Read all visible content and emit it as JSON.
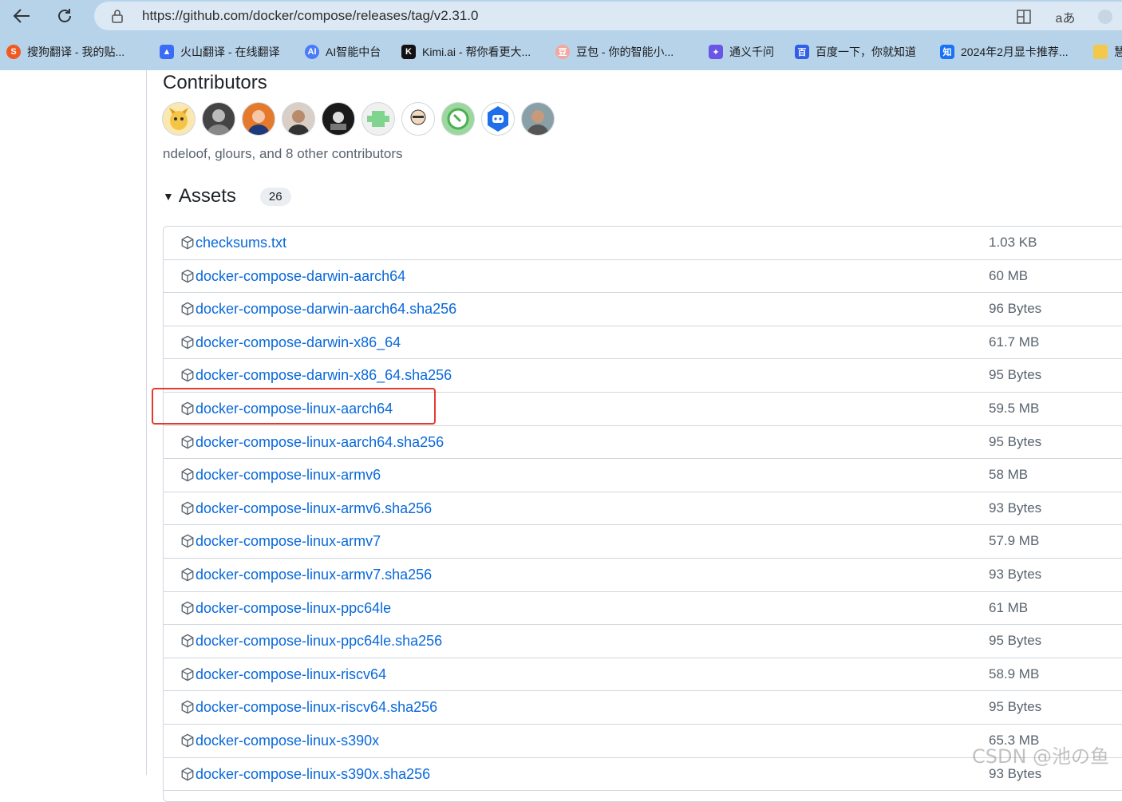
{
  "browser": {
    "url": "https://github.com/docker/compose/releases/tag/v2.31.0",
    "bookmarks": [
      {
        "label": "搜狗翻译 - 我的贴...",
        "icon": "sogou-icon",
        "color": "#f05a22"
      },
      {
        "label": "火山翻译 - 在线翻译",
        "icon": "volcano-icon",
        "color": "#3b6cf6"
      },
      {
        "label": "AI智能中台",
        "icon": "ai-icon",
        "color": "#4a7cf7"
      },
      {
        "label": "Kimi.ai - 帮你看更大...",
        "icon": "kimi-icon",
        "color": "#111111"
      },
      {
        "label": "豆包 - 你的智能小...",
        "icon": "doubao-icon",
        "color": "#f2a7a0"
      },
      {
        "label": "通义千问",
        "icon": "tongyi-icon",
        "color": "#6a55e6"
      },
      {
        "label": "百度一下，你就知道",
        "icon": "baidu-icon",
        "color": "#2f5fe6"
      },
      {
        "label": "2024年2月显卡推荐...",
        "icon": "zhihu-icon",
        "color": "#1772f6"
      },
      {
        "label": "慧",
        "icon": "folder-icon",
        "color": "#f2c94c"
      }
    ]
  },
  "contributors": {
    "title": "Contributors",
    "summary": "ndeloof, glours, and 8 other contributors",
    "avatars": [
      {
        "name": "avatar-1",
        "color": "#f6c445"
      },
      {
        "name": "avatar-2",
        "color": "#555555"
      },
      {
        "name": "avatar-3",
        "color": "#e57a2c"
      },
      {
        "name": "avatar-4",
        "color": "#8a6c58"
      },
      {
        "name": "avatar-5",
        "color": "#2b2b2b"
      },
      {
        "name": "avatar-6",
        "color": "#7fd48e"
      },
      {
        "name": "avatar-7",
        "color": "#f1e3d3"
      },
      {
        "name": "avatar-8",
        "color": "#4caf50"
      },
      {
        "name": "avatar-9",
        "color": "#1f6feb"
      },
      {
        "name": "avatar-10",
        "color": "#b08a6e"
      }
    ]
  },
  "assets": {
    "title": "Assets",
    "count": "26",
    "rows": [
      {
        "name": "checksums.txt",
        "size": "1.03 KB"
      },
      {
        "name": "docker-compose-darwin-aarch64",
        "size": "60 MB"
      },
      {
        "name": "docker-compose-darwin-aarch64.sha256",
        "size": "96 Bytes"
      },
      {
        "name": "docker-compose-darwin-x86_64",
        "size": "61.7 MB"
      },
      {
        "name": "docker-compose-darwin-x86_64.sha256",
        "size": "95 Bytes"
      },
      {
        "name": "docker-compose-linux-aarch64",
        "size": "59.5 MB"
      },
      {
        "name": "docker-compose-linux-aarch64.sha256",
        "size": "95 Bytes"
      },
      {
        "name": "docker-compose-linux-armv6",
        "size": "58 MB"
      },
      {
        "name": "docker-compose-linux-armv6.sha256",
        "size": "93 Bytes"
      },
      {
        "name": "docker-compose-linux-armv7",
        "size": "57.9 MB"
      },
      {
        "name": "docker-compose-linux-armv7.sha256",
        "size": "93 Bytes"
      },
      {
        "name": "docker-compose-linux-ppc64le",
        "size": "61 MB"
      },
      {
        "name": "docker-compose-linux-ppc64le.sha256",
        "size": "95 Bytes"
      },
      {
        "name": "docker-compose-linux-riscv64",
        "size": "58.9 MB"
      },
      {
        "name": "docker-compose-linux-riscv64.sha256",
        "size": "95 Bytes"
      },
      {
        "name": "docker-compose-linux-s390x",
        "size": "65.3 MB"
      },
      {
        "name": "docker-compose-linux-s390x.sha256",
        "size": "93 Bytes"
      }
    ]
  },
  "watermark": "CSDN @池の鱼",
  "colors": {
    "link": "#0969da",
    "highlight": "#e23b2e",
    "chrome": "#b7d3ea"
  }
}
